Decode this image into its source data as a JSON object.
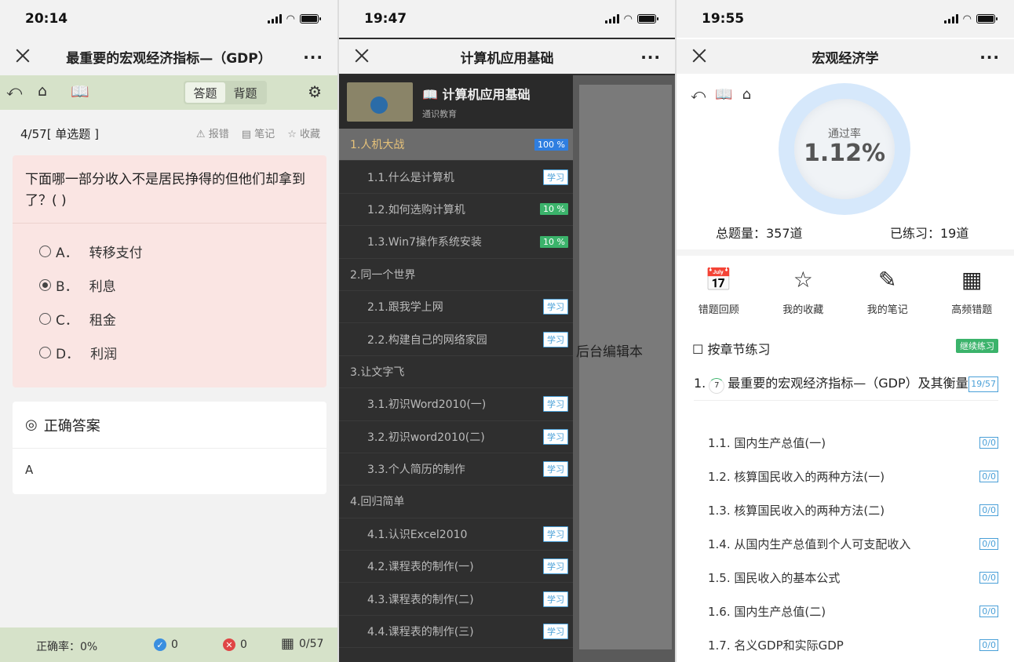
{
  "p1": {
    "time": "20:14",
    "title": "最重要的宏观经济指标—（GDP）",
    "tabs": [
      "答题",
      "背题"
    ],
    "progress": "4/57",
    "qtype": "[ 单选题 ]",
    "actions": [
      "报错",
      "笔记",
      "收藏"
    ],
    "question": "下面哪一部分收入不是居民挣得的但他们却拿到了？( )",
    "options": [
      {
        "l": "A．",
        "t": "转移支付"
      },
      {
        "l": "B．",
        "t": "利息"
      },
      {
        "l": "C．",
        "t": "租金"
      },
      {
        "l": "D．",
        "t": "利润"
      }
    ],
    "answer_title": "正确答案",
    "answer": "A",
    "accuracy": "正确率：0%",
    "right": "0",
    "wrong": "0",
    "count": "0/57"
  },
  "p2": {
    "time": "19:47",
    "title": "计算机应用基础",
    "course_title": "计算机应用基础",
    "course_sub": "通识教育",
    "bg_text": "后台编辑本",
    "rows": [
      {
        "t": "1.人机大战",
        "b": "100 %",
        "k": "chap active",
        "bk": "full"
      },
      {
        "t": "1.1.什么是计算机",
        "b": "学习",
        "k": "sub",
        "bk": "learn"
      },
      {
        "t": "1.2.如何选购计算机",
        "b": "10 %",
        "k": "sub",
        "bk": "pct"
      },
      {
        "t": "1.3.Win7操作系统安装",
        "b": "10 %",
        "k": "sub",
        "bk": "pct"
      },
      {
        "t": "2.同一个世界",
        "b": "",
        "k": "chap",
        "bk": ""
      },
      {
        "t": "2.1.跟我学上网",
        "b": "学习",
        "k": "sub",
        "bk": "learn"
      },
      {
        "t": "2.2.构建自己的网络家园",
        "b": "学习",
        "k": "sub",
        "bk": "learn"
      },
      {
        "t": "3.让文字飞",
        "b": "",
        "k": "chap",
        "bk": ""
      },
      {
        "t": "3.1.初识Word2010(一)",
        "b": "学习",
        "k": "sub",
        "bk": "learn"
      },
      {
        "t": "3.2.初识word2010(二)",
        "b": "学习",
        "k": "sub",
        "bk": "learn"
      },
      {
        "t": "3.3.个人简历的制作",
        "b": "学习",
        "k": "sub",
        "bk": "learn"
      },
      {
        "t": "4.回归简单",
        "b": "",
        "k": "chap",
        "bk": ""
      },
      {
        "t": "4.1.认识Excel2010",
        "b": "学习",
        "k": "sub",
        "bk": "learn"
      },
      {
        "t": "4.2.课程表的制作(一)",
        "b": "学习",
        "k": "sub",
        "bk": "learn"
      },
      {
        "t": "4.3.课程表的制作(二)",
        "b": "学习",
        "k": "sub",
        "bk": "learn"
      },
      {
        "t": "4.4.课程表的制作(三)",
        "b": "学习",
        "k": "sub",
        "bk": "learn"
      }
    ]
  },
  "p3": {
    "time": "19:55",
    "title": "宏观经济学",
    "pass_label": "通过率",
    "pass_value": "1.12%",
    "total": "总题量：357道",
    "practiced": "已练习：19道",
    "grid": [
      "错题回顾",
      "我的收藏",
      "我的笔记",
      "高频错题"
    ],
    "section": "按章节练习",
    "continue": "继续练习",
    "chapter_num": "1.",
    "chapter_spin": "7",
    "chapter": "最重要的宏观经济指标—（GDP）及其衡量",
    "chapter_count": "19/57",
    "items": [
      {
        "t": "1.1. 国内生产总值(一)",
        "c": "0/0"
      },
      {
        "t": "1.2. 核算国民收入的两种方法(一)",
        "c": "0/0"
      },
      {
        "t": "1.3. 核算国民收入的两种方法(二)",
        "c": "0/0"
      },
      {
        "t": "1.4. 从国内生产总值到个人可支配收入",
        "c": "0/0"
      },
      {
        "t": "1.5. 国民收入的基本公式",
        "c": "0/0"
      },
      {
        "t": "1.6. 国内生产总值(二)",
        "c": "0/0"
      },
      {
        "t": "1.7. 名义GDP和实际GDP",
        "c": "0/0"
      }
    ]
  }
}
